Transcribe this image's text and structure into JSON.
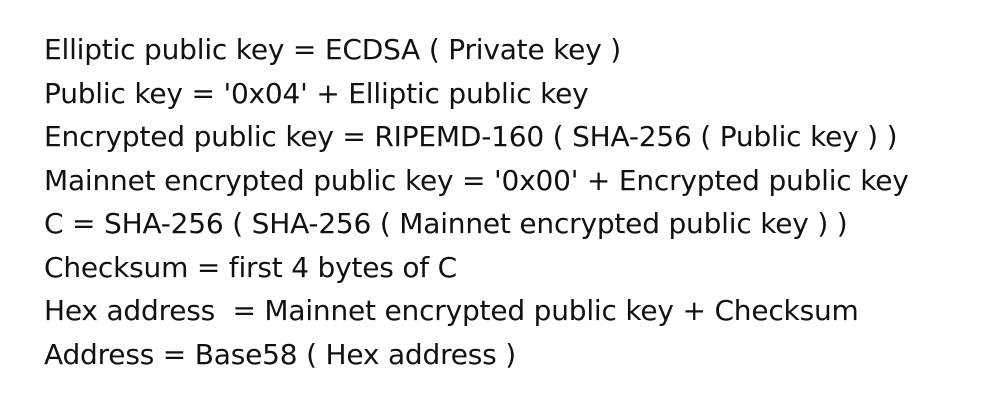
{
  "document": {
    "lines": [
      "Elliptic public key = ECDSA ( Private key )",
      "Public key = '0x04' + Elliptic public key",
      "Encrypted public key = RIPEMD-160 ( SHA-256 ( Public key ) )",
      "Mainnet encrypted public key = '0x00' + Encrypted public key",
      "C = SHA-256 ( SHA-256 ( Mainnet encrypted public key ) )",
      "Checksum = first 4 bytes of C",
      "Hex address  = Mainnet encrypted public key + Checksum",
      "Address = Base58 ( Hex address )"
    ]
  }
}
